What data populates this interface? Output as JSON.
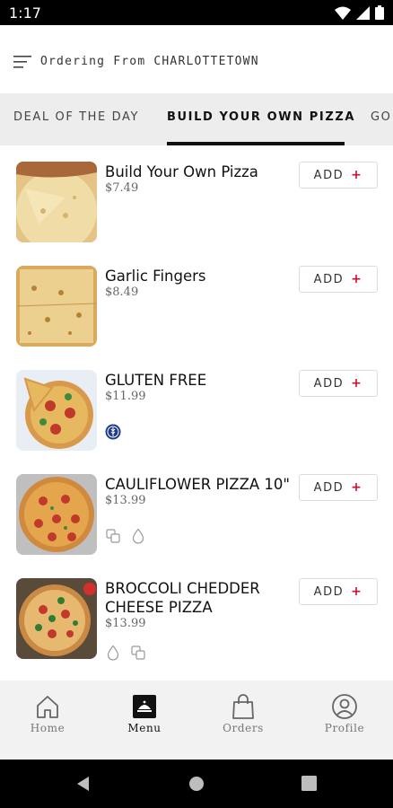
{
  "status_bar": {
    "time": "1:17"
  },
  "header": {
    "title": "Ordering From CHARLOTTETOWN"
  },
  "tabs": [
    {
      "label": "DEAL OF THE DAY"
    },
    {
      "label": "BUILD YOUR OWN PIZZA"
    },
    {
      "label": "GO"
    }
  ],
  "products": [
    {
      "name": "Build Your Own Pizza",
      "price": "$7.49",
      "add_label": "ADD",
      "plus": "+",
      "icons": []
    },
    {
      "name": "Garlic Fingers",
      "price": "$8.49",
      "add_label": "ADD",
      "plus": "+",
      "icons": []
    },
    {
      "name": "GLUTEN FREE",
      "price": "$11.99",
      "add_label": "ADD",
      "plus": "+",
      "icons": [
        "gluten-free-icon"
      ]
    },
    {
      "name": "CAULIFLOWER PIZZA 10\"",
      "price": "$13.99",
      "add_label": "ADD",
      "plus": "+",
      "icons": [
        "copy-icon",
        "drop-icon"
      ]
    },
    {
      "name": "BROCCOLI CHEDDER CHEESE PIZZA",
      "price": "$13.99",
      "add_label": "ADD",
      "plus": "+",
      "icons": [
        "drop-icon",
        "copy-icon"
      ]
    }
  ],
  "bottom_nav": [
    {
      "label": "Home",
      "icon": "home-icon"
    },
    {
      "label": "Menu",
      "icon": "menu-icon"
    },
    {
      "label": "Orders",
      "icon": "bag-icon"
    },
    {
      "label": "Profile",
      "icon": "profile-icon"
    }
  ],
  "colors": {
    "accent": "#d0102a",
    "tab_bg": "#ededed",
    "nav_bg": "#f2f2f2",
    "badge_blue": "#1f3c88"
  }
}
